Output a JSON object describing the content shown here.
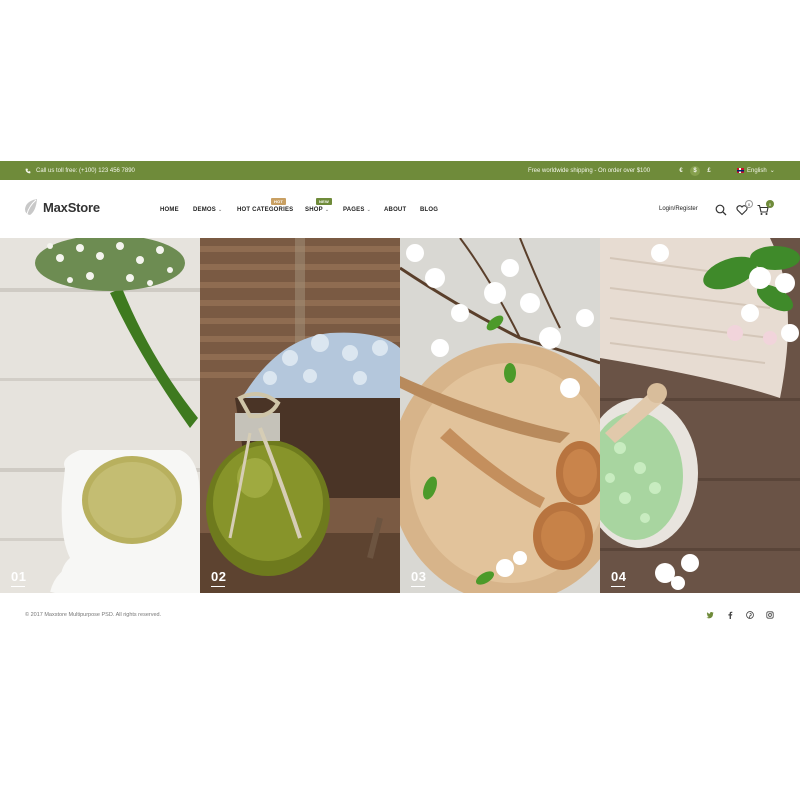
{
  "topbar": {
    "phone_text": "Call us toll free: (+100) 123 456 7890",
    "shipping_text": "Free worldwide shipping - On order over $100",
    "currencies": [
      "€",
      "$",
      "£"
    ],
    "active_currency": "$",
    "language": "English"
  },
  "header": {
    "logo": "MaxStore",
    "nav": [
      {
        "label": "HOME"
      },
      {
        "label": "DEMOS"
      },
      {
        "label": "HOT CATEGORIES",
        "badge": "HOT"
      },
      {
        "label": "SHOP",
        "badge": "NEW"
      },
      {
        "label": "PAGES"
      },
      {
        "label": "ABOUT"
      },
      {
        "label": "BLOG"
      }
    ],
    "login_label": "Login/Register",
    "wishlist_count": "0",
    "cart_count": "0"
  },
  "slides": [
    {
      "number": "01"
    },
    {
      "number": "02"
    },
    {
      "number": "03"
    },
    {
      "number": "04"
    }
  ],
  "footer": {
    "copyright": "© 2017 Maxstore Multipurpose PSD. All rights reserved.",
    "social_icons": [
      "twitter-icon",
      "facebook-icon",
      "pinterest-icon",
      "instagram-icon"
    ]
  },
  "colors": {
    "brand_green": "#6f8b3a",
    "hot_badge": "#c9a063"
  }
}
